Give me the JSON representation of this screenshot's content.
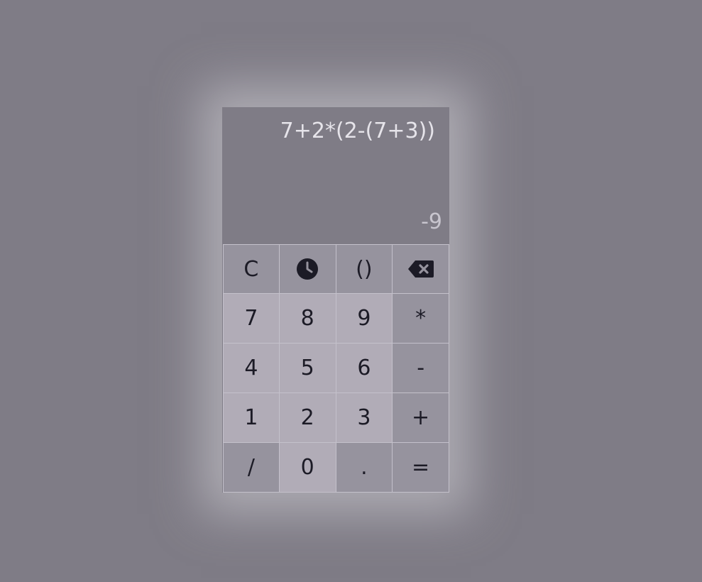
{
  "display": {
    "expression": "7+2*(2-(7+3))",
    "result": "-9"
  },
  "keys": {
    "clear": "C",
    "history_icon": "clock-icon",
    "parens": "()",
    "backspace_icon": "backspace-icon",
    "seven": "7",
    "eight": "8",
    "nine": "9",
    "multiply": "*",
    "four": "4",
    "five": "5",
    "six": "6",
    "minus": "-",
    "one": "1",
    "two": "2",
    "three": "3",
    "plus": "+",
    "divide": "/",
    "zero": "0",
    "decimal": ".",
    "equals": "="
  },
  "colors": {
    "background": "#7f7c86",
    "number_key": "#b1acb7",
    "operator_key": "#96939e",
    "key_text": "#1c1b26",
    "expression_text": "#e6e4ea",
    "result_text": "#c8c5ce"
  }
}
